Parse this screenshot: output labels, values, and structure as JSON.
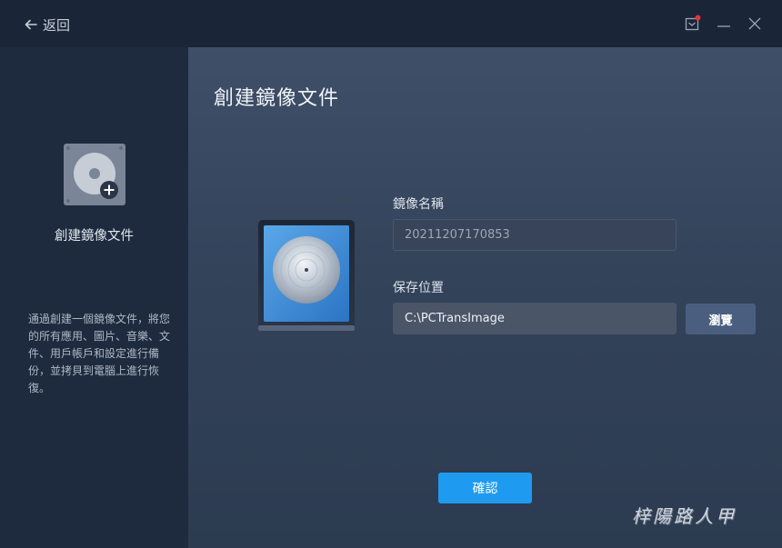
{
  "titlebar": {
    "back_label": "返回",
    "icons": {
      "back": "arrow-left-icon",
      "notify": "notification-icon",
      "minimize": "minimize-icon",
      "close": "close-icon"
    },
    "notify_badge_color": "#e5333a"
  },
  "sidebar": {
    "icon": "disk-image-add-icon",
    "title": "創建鏡像文件",
    "description": "通過創建一個鏡像文件，將您的所有應用、圖片、音樂、文件、用戶帳戶和設定進行備份，並拷貝到電腦上進行恢復。"
  },
  "main": {
    "title": "創建鏡像文件",
    "hero_icon": "disc-image-icon",
    "image_name": {
      "label": "鏡像名稱",
      "value": "20211207170853"
    },
    "save_location": {
      "label": "保存位置",
      "value": "C:\\PCTransImage"
    },
    "browse_label": "瀏覽",
    "confirm_label": "確認"
  },
  "watermark": "梓陽路人甲",
  "colors": {
    "accent": "#1e9bf0",
    "browse": "#4a5f80"
  }
}
